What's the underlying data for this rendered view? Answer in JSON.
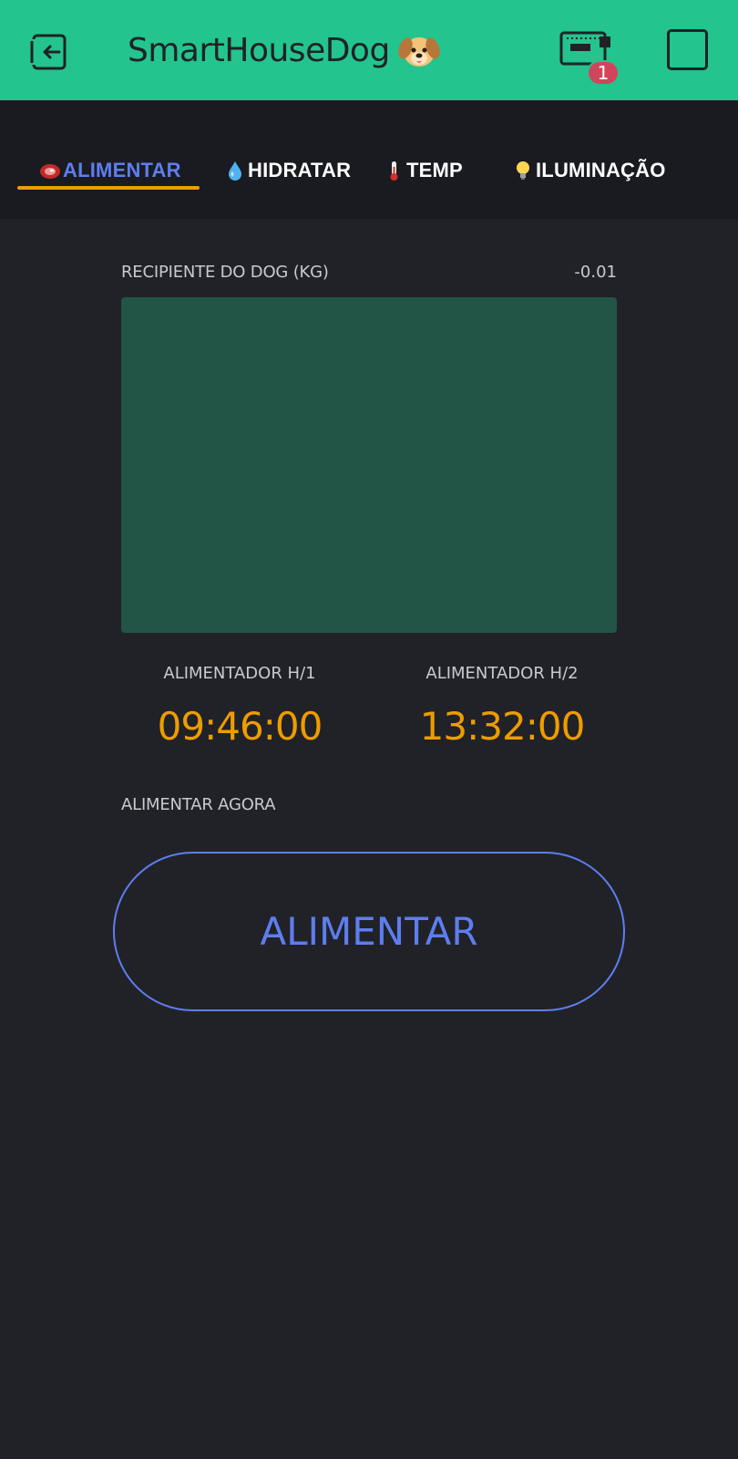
{
  "app": {
    "title": "SmartHouseDog",
    "title_icon": "dog-face-icon",
    "device_badge": "1",
    "colors": {
      "header": "#23c48e",
      "accent_blue": "#5d7ef0",
      "accent_orange": "#ed9d00",
      "level_fill": "#225546",
      "badge": "#d3435c",
      "background": "#212227"
    }
  },
  "tabs": [
    {
      "label": "ALIMENTAR",
      "icon": "meat-icon",
      "active": true
    },
    {
      "label": "HIDRATAR",
      "icon": "droplet-icon",
      "active": false
    },
    {
      "label": "TEMP",
      "icon": "thermometer-icon",
      "active": false
    },
    {
      "label": "ILUMINAÇÃO",
      "icon": "lightbulb-icon",
      "active": false
    }
  ],
  "level": {
    "label": "RECIPIENTE DO DOG (KG)",
    "value": "-0.01",
    "fill_fraction": 1.0
  },
  "timers": [
    {
      "label": "ALIMENTADOR H/1",
      "value": "09:46:00"
    },
    {
      "label": "ALIMENTADOR H/2",
      "value": "13:32:00"
    }
  ],
  "feed_now": {
    "label": "ALIMENTAR AGORA",
    "button_label": "ALIMENTAR"
  }
}
